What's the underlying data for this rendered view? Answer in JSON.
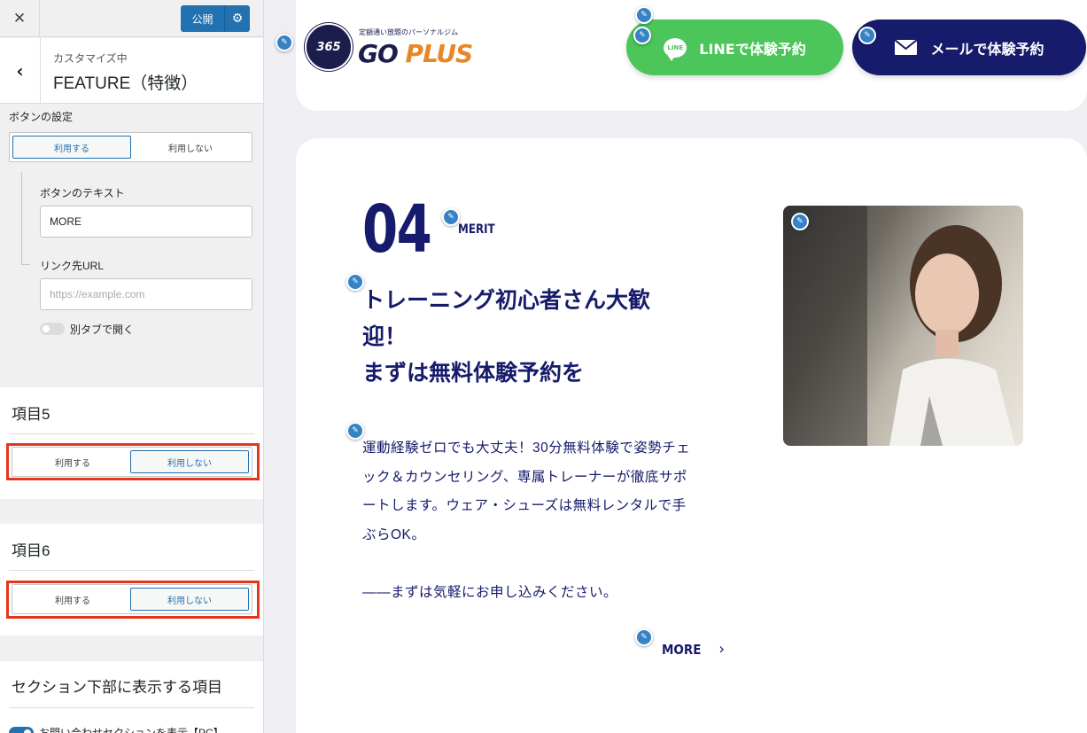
{
  "customizer": {
    "publish_label": "公開",
    "header_subtitle": "カスタマイズ中",
    "header_title": "FEATURE（特徴）",
    "button_settings_label": "ボタンの設定",
    "use_label": "利用する",
    "nouse_label": "利用しない",
    "button_text_label": "ボタンのテキスト",
    "button_text_value": "MORE",
    "link_url_label": "リンク先URL",
    "link_url_placeholder": "https://example.com",
    "new_tab_label": "別タブで開く",
    "item5_title": "項目5",
    "item6_title": "項目6",
    "bottom_section_title": "セクション下部に表示する項目",
    "contact_section_label": "お問い合わせセクションを表示【PC】"
  },
  "preview": {
    "logo": {
      "circle_text": "365",
      "tagline": "定額通い放題のパーソナルジム",
      "go": "GO",
      "plus": "PLUS"
    },
    "cta_line": {
      "icon_text": "LINE",
      "label": "LINEで体験予約"
    },
    "cta_mail": {
      "label": "メールで体験予約"
    },
    "feature": {
      "number": "04",
      "merit": "MERIT",
      "title_lines": [
        "トレーニング初心者さん大歓",
        "迎！",
        "まずは無料体験予約を"
      ],
      "body_lines": [
        "運動経験ゼロでも大丈夫！30分無料体験で姿勢チェ",
        "ック＆カウンセリング、専属トレーナーが徹底サポ",
        "ートします。ウェア・シューズは無料レンタルで手",
        "ぶらOK。",
        "",
        "——まずは気軽にお申し込みください。"
      ],
      "more_label": "MORE"
    }
  },
  "colors": {
    "brand_navy": "#161b6b",
    "line_green": "#4cc55a",
    "wp_blue": "#2271b1",
    "highlight_red": "#e3361c",
    "logo_orange": "#e8862a"
  }
}
